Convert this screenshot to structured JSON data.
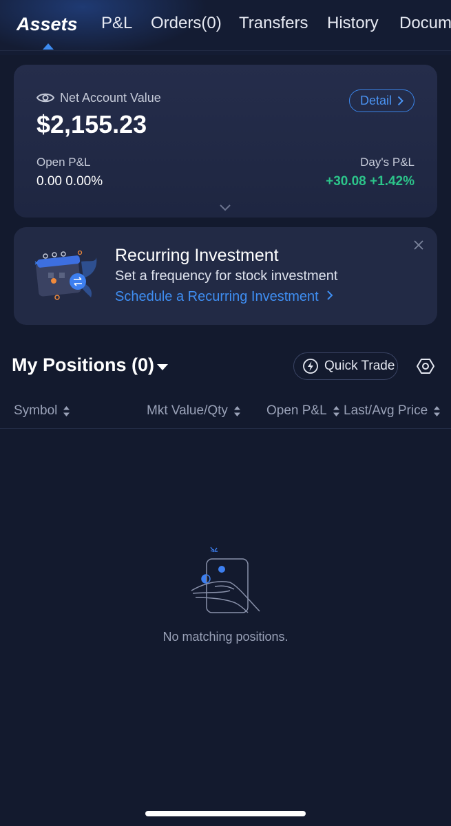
{
  "tabs": [
    {
      "label": "Assets",
      "active": true
    },
    {
      "label": "P&L"
    },
    {
      "label": "Orders(0)"
    },
    {
      "label": "Transfers"
    },
    {
      "label": "History"
    },
    {
      "label": "Docum"
    }
  ],
  "account": {
    "net_label": "Net Account Value",
    "net_value": "$2,155.23",
    "detail_label": "Detail",
    "open_pl_label": "Open P&L",
    "open_pl_value": "0.00 0.00%",
    "day_pl_label": "Day's P&L",
    "day_pl_value": "+30.08 +1.42%"
  },
  "recurring": {
    "title": "Recurring Investment",
    "subtitle": "Set a frequency for stock investment",
    "link": "Schedule a Recurring Investment"
  },
  "positions": {
    "title": "My Positions (0)",
    "quick_trade_label": "Quick Trade",
    "columns": [
      "Symbol",
      "Mkt Value/Qty",
      "Open P&L",
      "Last/Avg Price"
    ],
    "empty_text": "No matching positions."
  },
  "colors": {
    "accent": "#3d8bf0",
    "positive": "#2cc48a",
    "background": "#131a2e"
  },
  "icons": [
    "eye-icon",
    "chevron-right-icon",
    "chevron-down-icon",
    "close-icon",
    "lightning-icon",
    "settings-hexagon-icon",
    "sort-icon"
  ]
}
